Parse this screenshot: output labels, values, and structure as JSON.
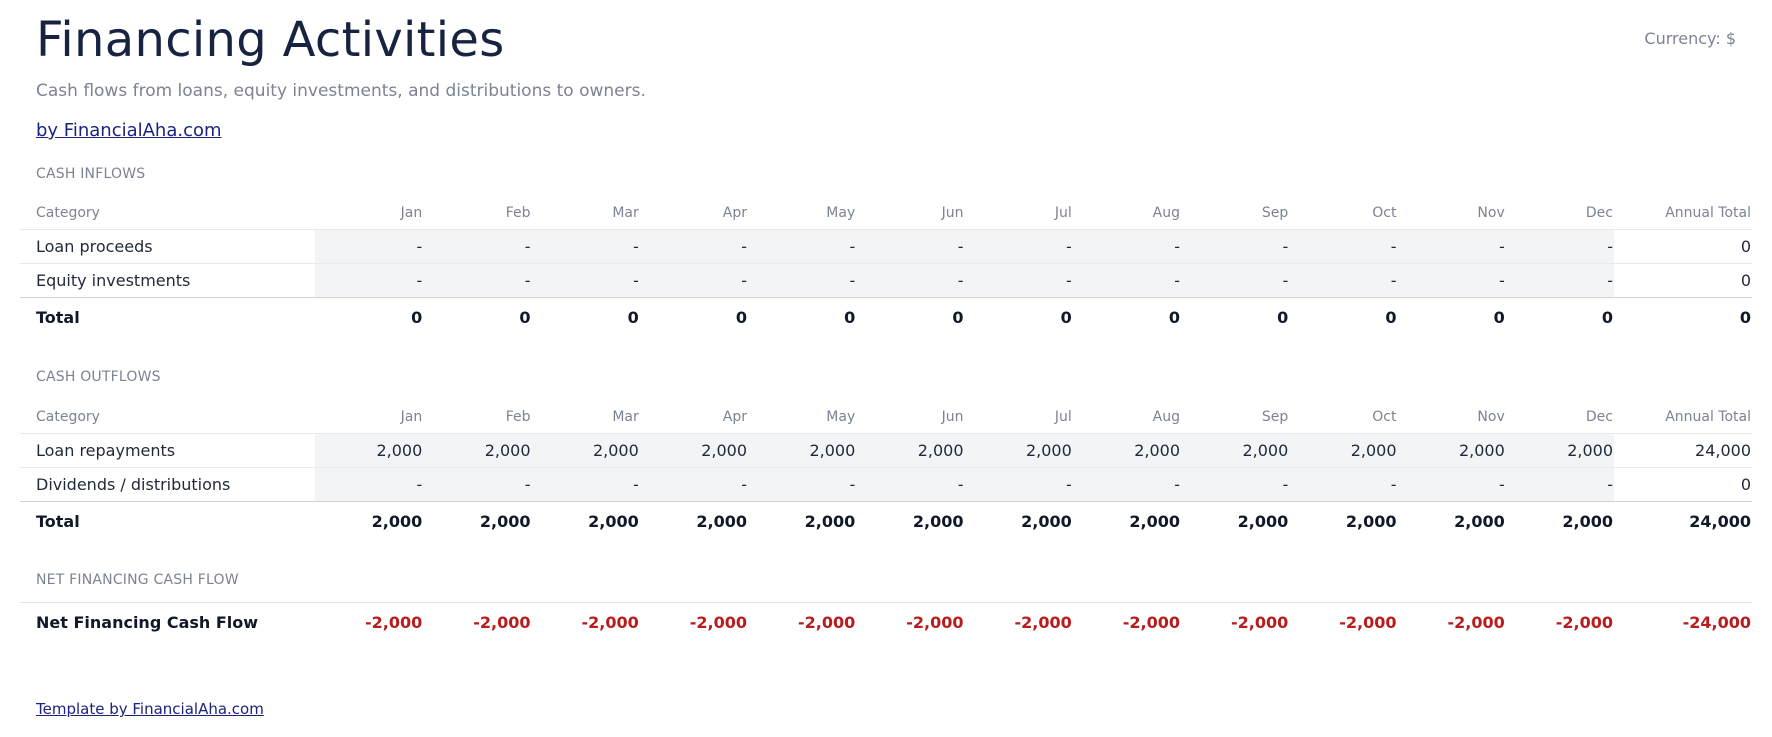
{
  "header": {
    "title": "Financing Activities",
    "currency": "Currency: $",
    "subtitle": "Cash flows from loans, equity investments, and distributions to owners.",
    "byline": "by FinancialAha.com"
  },
  "columns": {
    "category": "Category",
    "months": [
      "Jan",
      "Feb",
      "Mar",
      "Apr",
      "May",
      "Jun",
      "Jul",
      "Aug",
      "Sep",
      "Oct",
      "Nov",
      "Dec"
    ],
    "annual_total": "Annual Total"
  },
  "inflows": {
    "label": "CASH INFLOWS",
    "rows": [
      {
        "name": "Loan proceeds",
        "values": [
          "-",
          "-",
          "-",
          "-",
          "-",
          "-",
          "-",
          "-",
          "-",
          "-",
          "-",
          "-"
        ],
        "total": "0"
      },
      {
        "name": "Equity investments",
        "values": [
          "-",
          "-",
          "-",
          "-",
          "-",
          "-",
          "-",
          "-",
          "-",
          "-",
          "-",
          "-"
        ],
        "total": "0"
      }
    ],
    "total": {
      "name": "Total",
      "values": [
        "0",
        "0",
        "0",
        "0",
        "0",
        "0",
        "0",
        "0",
        "0",
        "0",
        "0",
        "0"
      ],
      "total": "0"
    }
  },
  "outflows": {
    "label": "CASH OUTFLOWS",
    "rows": [
      {
        "name": "Loan repayments",
        "values": [
          "2,000",
          "2,000",
          "2,000",
          "2,000",
          "2,000",
          "2,000",
          "2,000",
          "2,000",
          "2,000",
          "2,000",
          "2,000",
          "2,000"
        ],
        "total": "24,000"
      },
      {
        "name": "Dividends / distributions",
        "values": [
          "-",
          "-",
          "-",
          "-",
          "-",
          "-",
          "-",
          "-",
          "-",
          "-",
          "-",
          "-"
        ],
        "total": "0"
      }
    ],
    "total": {
      "name": "Total",
      "values": [
        "2,000",
        "2,000",
        "2,000",
        "2,000",
        "2,000",
        "2,000",
        "2,000",
        "2,000",
        "2,000",
        "2,000",
        "2,000",
        "2,000"
      ],
      "total": "24,000"
    }
  },
  "net": {
    "label": "NET FINANCING CASH FLOW",
    "row": {
      "name": "Net Financing Cash Flow",
      "values": [
        "-2,000",
        "-2,000",
        "-2,000",
        "-2,000",
        "-2,000",
        "-2,000",
        "-2,000",
        "-2,000",
        "-2,000",
        "-2,000",
        "-2,000",
        "-2,000"
      ],
      "total": "-24,000"
    }
  },
  "footer": {
    "link": "Template by FinancialAha.com"
  },
  "colors": {
    "title": "#172340",
    "muted": "#7b8394",
    "input_fill": "#f3f4f6",
    "negative": "#b91c1c",
    "link": "#1a237e"
  }
}
